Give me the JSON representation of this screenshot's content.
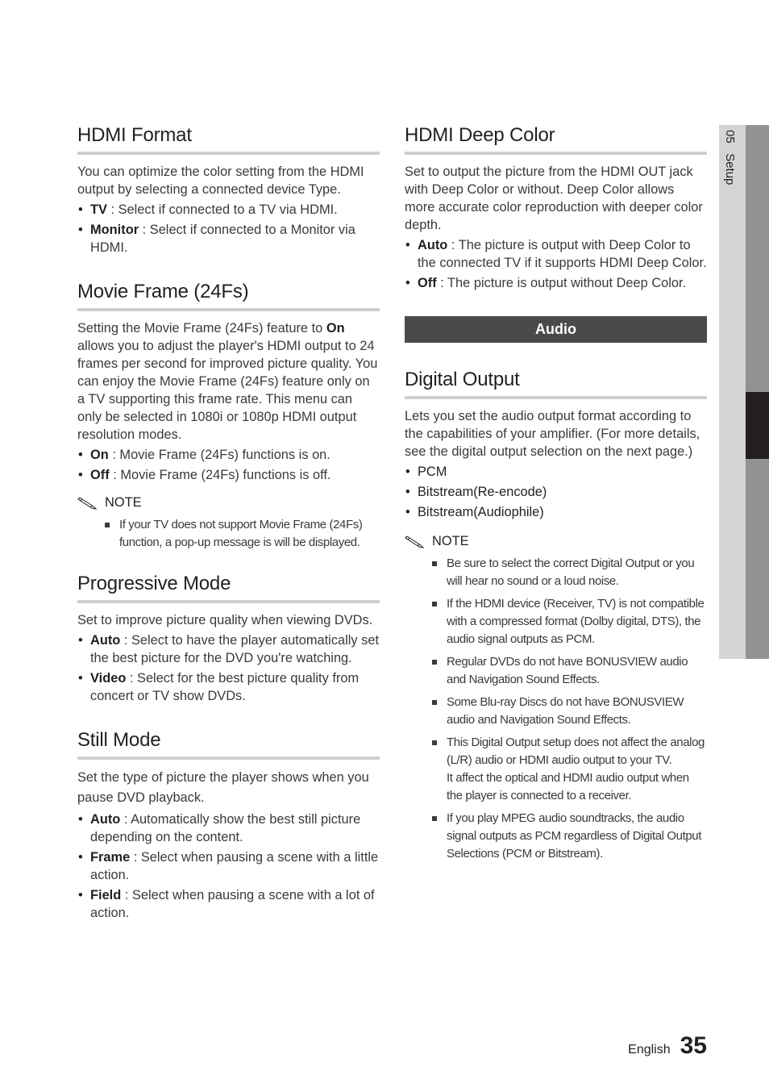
{
  "side_tab": {
    "chapter": "05",
    "label": "Setup"
  },
  "footer": {
    "language": "English",
    "page_number": "35"
  },
  "left_column": {
    "hdmi_format": {
      "title": "HDMI Format",
      "body": "You can optimize the color setting from the HDMI output by selecting a connected device Type.",
      "bullets": [
        {
          "term": "TV",
          "text": " : Select if connected to a TV via HDMI."
        },
        {
          "term": "Monitor",
          "text": " : Select if connected to a Monitor via HDMI."
        }
      ]
    },
    "movie_frame": {
      "title": "Movie Frame (24Fs)",
      "body_prefix": "Setting the Movie Frame (24Fs) feature to ",
      "body_bold": "On",
      "body_suffix": " allows you to adjust the player's HDMI output to 24 frames per second for improved picture quality. You can enjoy the Movie Frame (24Fs) feature only on a TV supporting this frame rate. This menu can only be selected in 1080i or 1080p HDMI output resolution modes.",
      "bullets": [
        {
          "term": "On",
          "text": " : Movie Frame (24Fs) functions is on."
        },
        {
          "term": "Off",
          "text": " : Movie Frame (24Fs) functions is off."
        }
      ],
      "note_label": "NOTE",
      "notes": [
        "If your TV does not support Movie Frame (24Fs) function, a pop-up message is will be displayed."
      ]
    },
    "progressive_mode": {
      "title": "Progressive Mode",
      "body": "Set to improve picture quality when viewing DVDs.",
      "bullets": [
        {
          "term": "Auto",
          "text": " : Select to have the player automatically set the best picture for the DVD you're watching."
        },
        {
          "term": "Video",
          "text": " : Select for the best picture quality from concert or TV show DVDs."
        }
      ]
    },
    "still_mode": {
      "title": "Still Mode",
      "body": "Set the type of picture the player shows when you pause DVD playback.",
      "bullets": [
        {
          "term": "Auto",
          "text": " : Automatically show the best still picture depending on the content."
        },
        {
          "term": "Frame",
          "text": " : Select when pausing a scene with a little action."
        },
        {
          "term": "Field",
          "text": " : Select when pausing a scene with a lot of action."
        }
      ]
    }
  },
  "right_column": {
    "hdmi_deep_color": {
      "title": "HDMI Deep Color",
      "body": "Set to output the picture from the HDMI OUT jack with Deep Color or without. Deep Color allows more accurate color reproduction with deeper color depth.",
      "bullets": [
        {
          "term": "Auto",
          "text": " : The picture is output with Deep Color to the connected TV if it supports HDMI Deep Color."
        },
        {
          "term": "Off",
          "text": " : The picture is output without Deep Color."
        }
      ]
    },
    "audio_band": "Audio",
    "digital_output": {
      "title": "Digital Output",
      "body": "Lets you set the audio output format according to the capabilities of your amplifier. (For more details, see the digital output selection on the next page.)",
      "options": [
        "PCM",
        "Bitstream(Re-encode)",
        "Bitstream(Audiophile)"
      ],
      "note_label": "NOTE",
      "notes": [
        "Be sure to select the correct Digital Output or you will hear no sound or a loud noise.",
        "If the HDMI device (Receiver, TV) is not compatible with a compressed format (Dolby digital, DTS), the audio signal outputs as PCM.",
        "Regular DVDs do not have BONUSVIEW audio and Navigation Sound Effects.",
        "Some Blu-ray Discs do not have BONUSVIEW audio and Navigation Sound Effects.",
        "This Digital Output setup does not affect the analog (L/R) audio or HDMI audio output to your TV.\nIt affect the optical and HDMI audio output when the player is connected to a receiver.",
        "If you play MPEG audio soundtracks, the audio signal outputs as PCM regardless of Digital Output Selections (PCM or Bitstream)."
      ]
    }
  },
  "colors": {
    "band_bg": "#4a4a4a",
    "rule": "#cfcfcf",
    "side_light": "#d4d4d4",
    "side_mid": "#929292",
    "side_dark": "#231f20"
  }
}
